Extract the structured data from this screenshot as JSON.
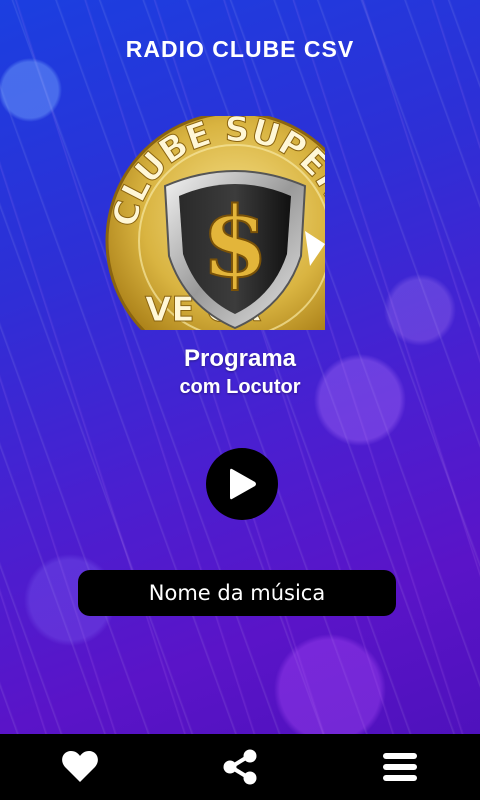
{
  "header": {
    "title": "RADIO CLUBE CSV"
  },
  "logo": {
    "top_text": "CLUBE SUPER",
    "bottom_text": "VE OR",
    "symbol": "$"
  },
  "program": {
    "name": "Programa",
    "host": "com Locutor"
  },
  "player": {
    "play_icon": "play-icon"
  },
  "song": {
    "title": "Nome da música"
  },
  "bottom_nav": {
    "items": [
      {
        "icon": "heart-icon"
      },
      {
        "icon": "share-icon"
      },
      {
        "icon": "menu-icon"
      }
    ]
  },
  "colors": {
    "background_top": "#1b3fe0",
    "background_bottom": "#5a14c8",
    "gold": "#d9b441",
    "bar": "#000000"
  }
}
